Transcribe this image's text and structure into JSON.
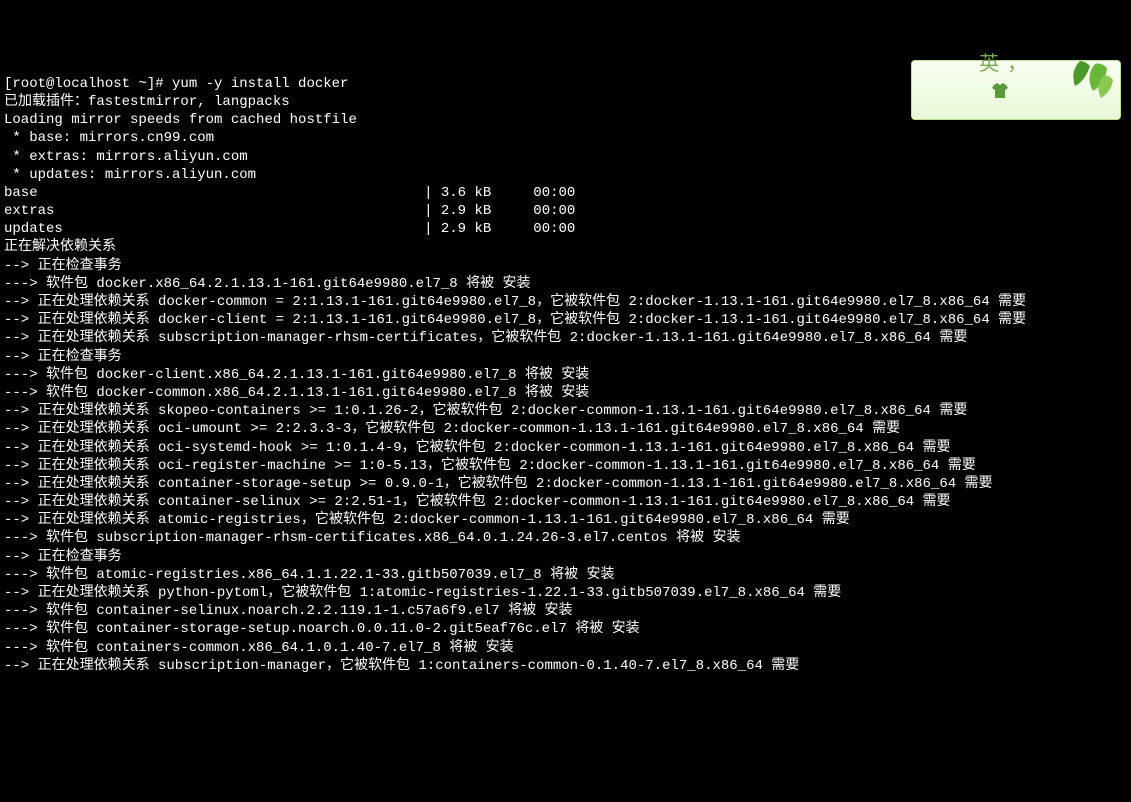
{
  "prompt": "[root@localhost ~]# ",
  "command": "yum -y install docker",
  "lines": [
    "已加载插件：fastestmirror, langpacks",
    "Loading mirror speeds from cached hostfile",
    " * base: mirrors.cn99.com",
    " * extras: mirrors.aliyun.com",
    " * updates: mirrors.aliyun.com",
    "base                                              | 3.6 kB     00:00",
    "extras                                            | 2.9 kB     00:00",
    "updates                                           | 2.9 kB     00:00",
    "正在解决依赖关系",
    "--> 正在检查事务",
    "---> 软件包 docker.x86_64.2.1.13.1-161.git64e9980.el7_8 将被 安装",
    "--> 正在处理依赖关系 docker-common = 2:1.13.1-161.git64e9980.el7_8，它被软件包 2:docker-1.13.1-161.git64e9980.el7_8.x86_64 需要",
    "--> 正在处理依赖关系 docker-client = 2:1.13.1-161.git64e9980.el7_8，它被软件包 2:docker-1.13.1-161.git64e9980.el7_8.x86_64 需要",
    "--> 正在处理依赖关系 subscription-manager-rhsm-certificates，它被软件包 2:docker-1.13.1-161.git64e9980.el7_8.x86_64 需要",
    "--> 正在检查事务",
    "---> 软件包 docker-client.x86_64.2.1.13.1-161.git64e9980.el7_8 将被 安装",
    "---> 软件包 docker-common.x86_64.2.1.13.1-161.git64e9980.el7_8 将被 安装",
    "--> 正在处理依赖关系 skopeo-containers >= 1:0.1.26-2，它被软件包 2:docker-common-1.13.1-161.git64e9980.el7_8.x86_64 需要",
    "--> 正在处理依赖关系 oci-umount >= 2:2.3.3-3，它被软件包 2:docker-common-1.13.1-161.git64e9980.el7_8.x86_64 需要",
    "--> 正在处理依赖关系 oci-systemd-hook >= 1:0.1.4-9，它被软件包 2:docker-common-1.13.1-161.git64e9980.el7_8.x86_64 需要",
    "--> 正在处理依赖关系 oci-register-machine >= 1:0-5.13，它被软件包 2:docker-common-1.13.1-161.git64e9980.el7_8.x86_64 需要",
    "--> 正在处理依赖关系 container-storage-setup >= 0.9.0-1，它被软件包 2:docker-common-1.13.1-161.git64e9980.el7_8.x86_64 需要",
    "--> 正在处理依赖关系 container-selinux >= 2:2.51-1，它被软件包 2:docker-common-1.13.1-161.git64e9980.el7_8.x86_64 需要",
    "--> 正在处理依赖关系 atomic-registries，它被软件包 2:docker-common-1.13.1-161.git64e9980.el7_8.x86_64 需要",
    "---> 软件包 subscription-manager-rhsm-certificates.x86_64.0.1.24.26-3.el7.centos 将被 安装",
    "--> 正在检查事务",
    "---> 软件包 atomic-registries.x86_64.1.1.22.1-33.gitb507039.el7_8 将被 安装",
    "--> 正在处理依赖关系 python-pytoml，它被软件包 1:atomic-registries-1.22.1-33.gitb507039.el7_8.x86_64 需要",
    "---> 软件包 container-selinux.noarch.2.2.119.1-1.c57a6f9.el7 将被 安装",
    "---> 软件包 container-storage-setup.noarch.0.0.11.0-2.git5eaf76c.el7 将被 安装",
    "---> 软件包 containers-common.x86_64.1.0.1.40-7.el7_8 将被 安装",
    "--> 正在处理依赖关系 subscription-manager，它被软件包 1:containers-common-0.1.40-7.el7_8.x86_64 需要"
  ],
  "ime": {
    "lang": "英",
    "comma": "，",
    "shirt_icon": "👕"
  }
}
